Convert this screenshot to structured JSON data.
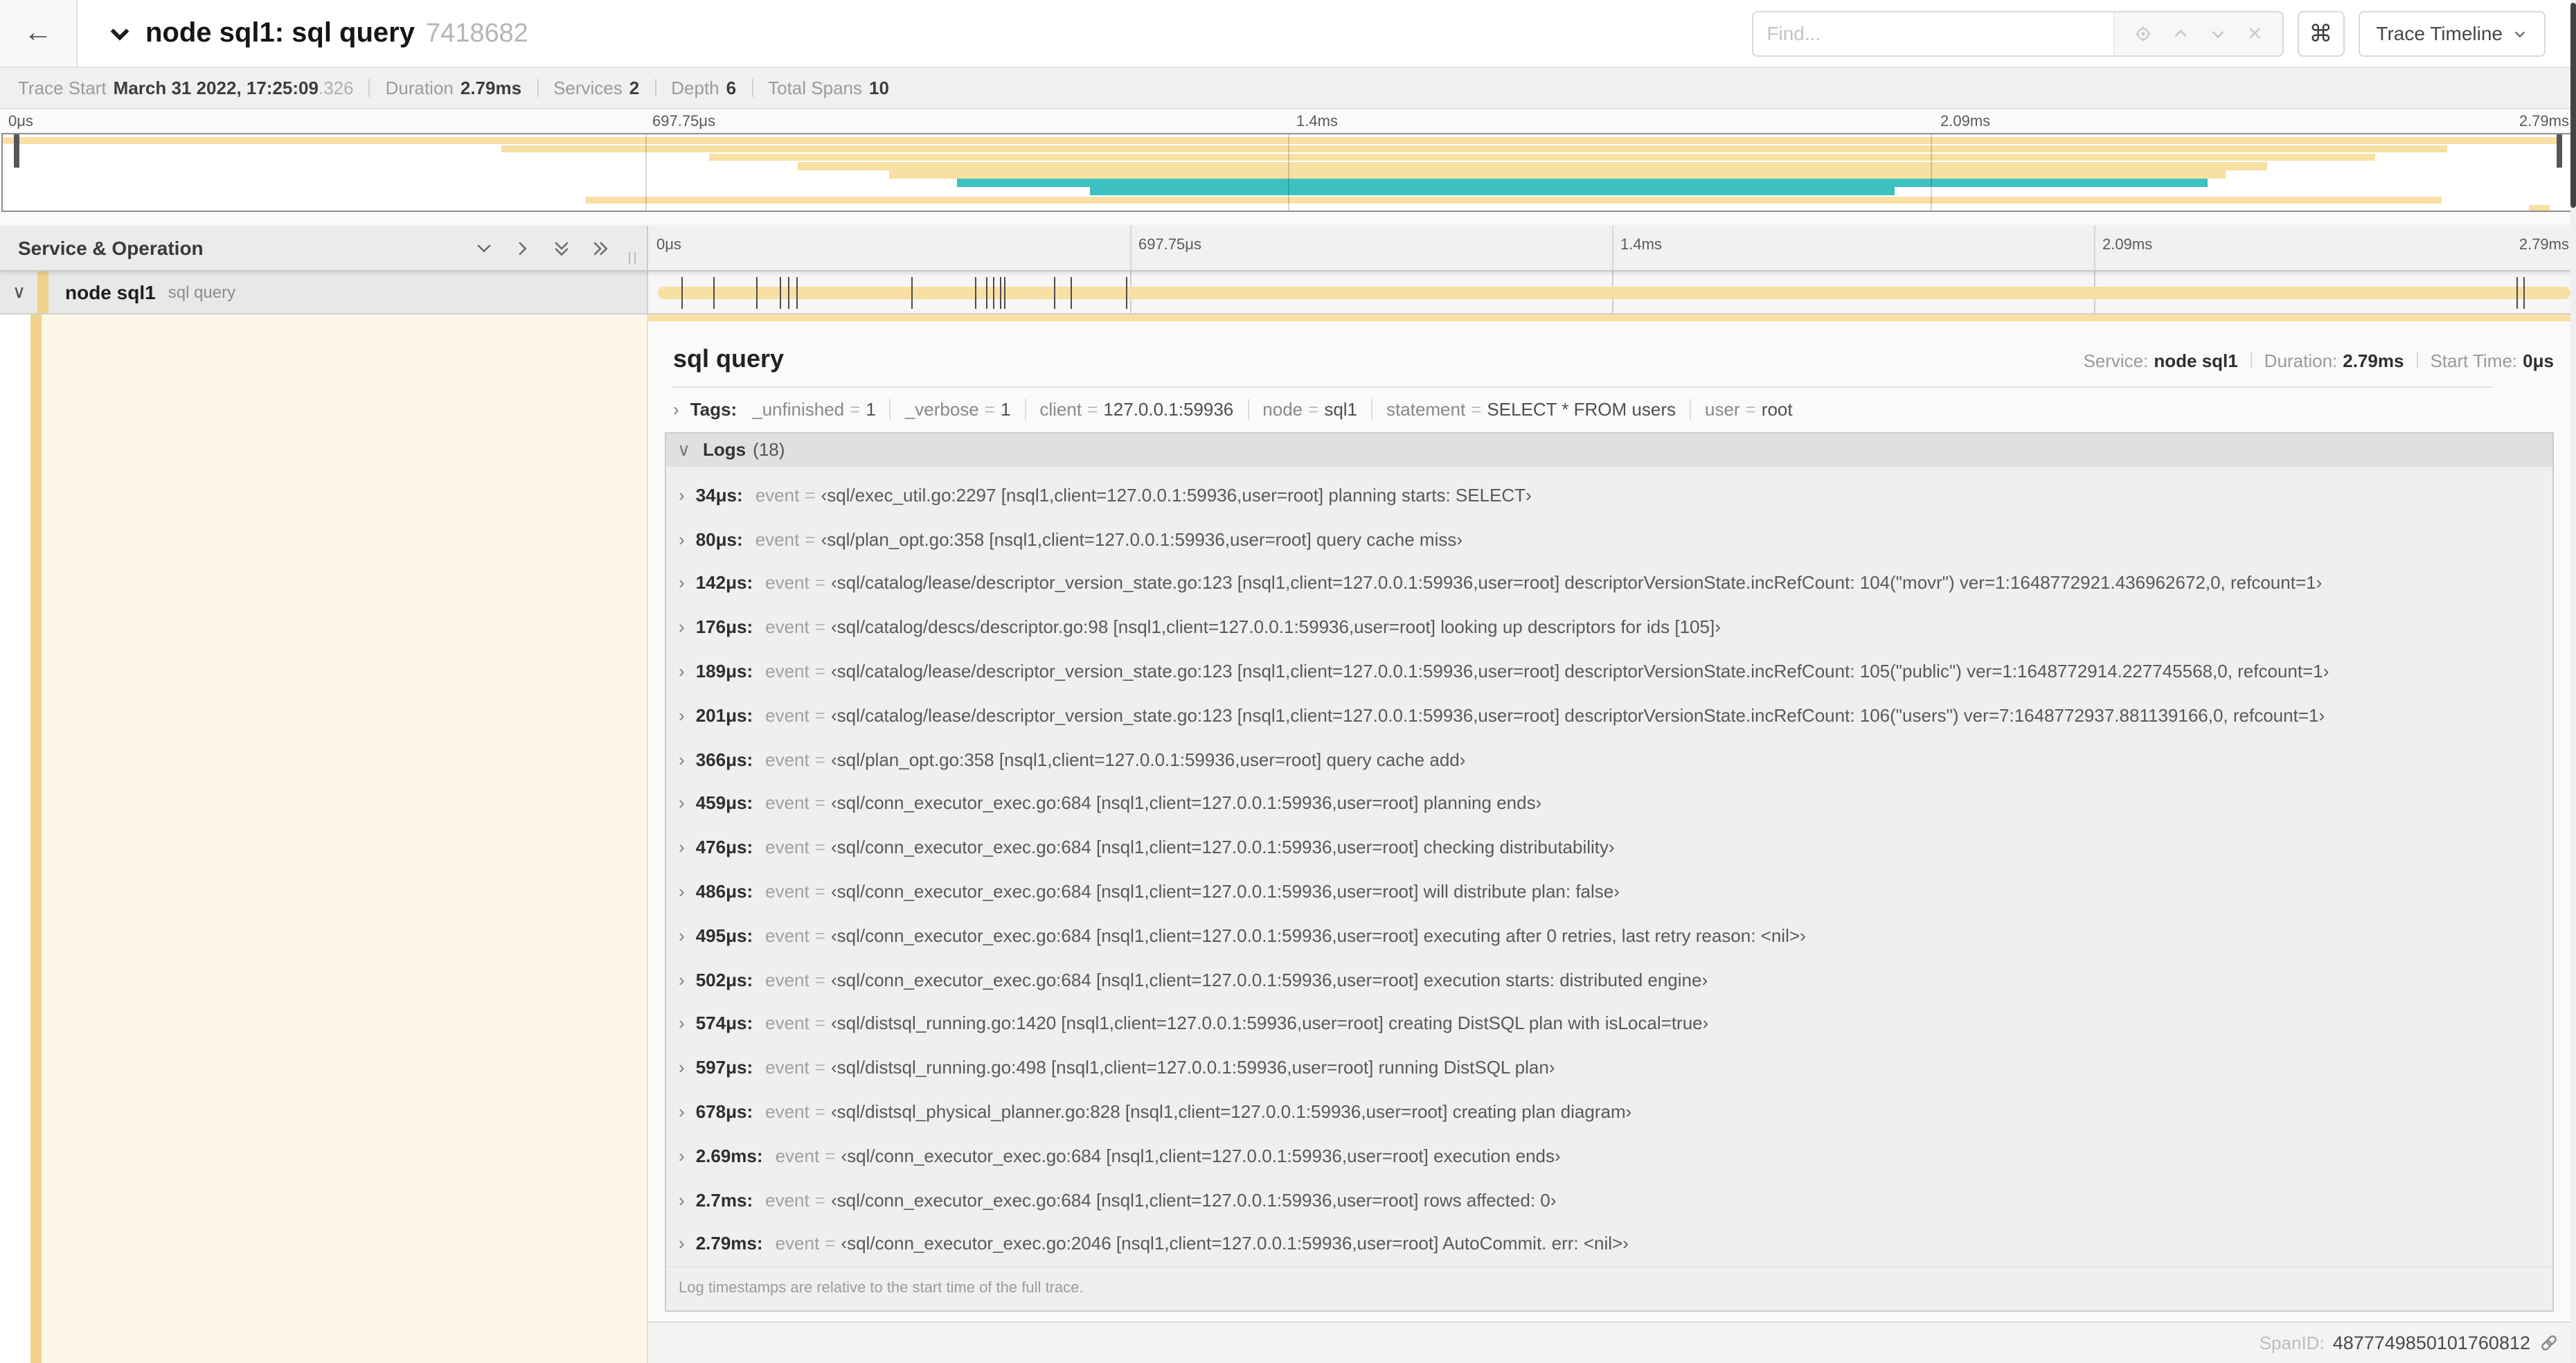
{
  "topbar": {
    "back_icon": "←",
    "title": "node sql1: sql query",
    "trace_id": "7418682",
    "find_placeholder": "Find...",
    "find_icons": [
      "locate-icon",
      "prev-result-icon",
      "next-result-icon",
      "clear-icon"
    ],
    "shortcut_icon": "⌘",
    "view_button": "Trace Timeline"
  },
  "stats": [
    {
      "name": "trace-start",
      "label": "Trace Start",
      "value": "March 31 2022, 17:25:09",
      "suffix": ".326"
    },
    {
      "name": "duration",
      "label": "Duration",
      "value": "2.79ms",
      "suffix": ""
    },
    {
      "name": "services",
      "label": "Services",
      "value": "2",
      "suffix": ""
    },
    {
      "name": "depth",
      "label": "Depth",
      "value": "6",
      "suffix": ""
    },
    {
      "name": "total-spans",
      "label": "Total Spans",
      "value": "10",
      "suffix": ""
    }
  ],
  "ruler_labels": [
    "0μs",
    "697.75μs",
    "1.4ms",
    "2.09ms",
    "2.79ms"
  ],
  "minimap": {
    "bars": [
      {
        "s": 0,
        "e": 99.4,
        "c": "tan"
      },
      {
        "s": 19.4,
        "e": 95.1,
        "c": "tan"
      },
      {
        "s": 27.5,
        "e": 92.3,
        "c": "tan"
      },
      {
        "s": 30.9,
        "e": 88.1,
        "c": "tan"
      },
      {
        "s": 34.5,
        "e": 86.5,
        "c": "tan"
      },
      {
        "s": 37.1,
        "e": 85.8,
        "c": "teal"
      },
      {
        "s": 42.3,
        "e": 73.6,
        "c": "teal"
      },
      {
        "s": 22.7,
        "e": 94.9,
        "c": "tan"
      },
      {
        "s": 98.3,
        "e": 99.1,
        "c": "tan"
      }
    ]
  },
  "timeline": {
    "header_label": "Service & Operation",
    "collapse_icons": [
      "chevron-down",
      "chevron-right",
      "double-chevron-down",
      "double-chevron-right"
    ]
  },
  "row": {
    "service": "node sql1",
    "operation": "sql query",
    "chevron": "∨"
  },
  "trace": {
    "duration_us": 2790
  },
  "detail": {
    "title": "sql query",
    "service_label": "Service:",
    "service_value": "node sql1",
    "duration_label": "Duration:",
    "duration_value": "2.79ms",
    "start_label": "Start Time:",
    "start_value": "0μs",
    "tags_label": "Tags:",
    "tags": [
      {
        "key": "_unfinished",
        "value": "1"
      },
      {
        "key": "_verbose",
        "value": "1"
      },
      {
        "key": "client",
        "value": "127.0.0.1:59936"
      },
      {
        "key": "node",
        "value": "sql1"
      },
      {
        "key": "statement",
        "value": "SELECT * FROM users"
      },
      {
        "key": "user",
        "value": "root"
      }
    ],
    "logs_label": "Logs",
    "logs_count": "(18)",
    "log_key": "event",
    "logs": [
      {
        "time": "34μs",
        "text": "sql/exec_util.go:2297 [nsql1,client=127.0.0.1:59936,user=root] planning starts: SELECT"
      },
      {
        "time": "80μs",
        "text": "sql/plan_opt.go:358 [nsql1,client=127.0.0.1:59936,user=root] query cache miss"
      },
      {
        "time": "142μs",
        "text": "sql/catalog/lease/descriptor_version_state.go:123 [nsql1,client=127.0.0.1:59936,user=root] descriptorVersionState.incRefCount: 104(\"movr\") ver=1:1648772921.436962672,0, refcount=1"
      },
      {
        "time": "176μs",
        "text": "sql/catalog/descs/descriptor.go:98 [nsql1,client=127.0.0.1:59936,user=root] looking up descriptors for ids [105]"
      },
      {
        "time": "189μs",
        "text": "sql/catalog/lease/descriptor_version_state.go:123 [nsql1,client=127.0.0.1:59936,user=root] descriptorVersionState.incRefCount: 105(\"public\") ver=1:1648772914.227745568,0, refcount=1"
      },
      {
        "time": "201μs",
        "text": "sql/catalog/lease/descriptor_version_state.go:123 [nsql1,client=127.0.0.1:59936,user=root] descriptorVersionState.incRefCount: 106(\"users\") ver=7:1648772937.881139166,0, refcount=1"
      },
      {
        "time": "366μs",
        "text": "sql/plan_opt.go:358 [nsql1,client=127.0.0.1:59936,user=root] query cache add"
      },
      {
        "time": "459μs",
        "text": "sql/conn_executor_exec.go:684 [nsql1,client=127.0.0.1:59936,user=root] planning ends"
      },
      {
        "time": "476μs",
        "text": "sql/conn_executor_exec.go:684 [nsql1,client=127.0.0.1:59936,user=root] checking distributability"
      },
      {
        "time": "486μs",
        "text": "sql/conn_executor_exec.go:684 [nsql1,client=127.0.0.1:59936,user=root] will distribute plan: false"
      },
      {
        "time": "495μs",
        "text": "sql/conn_executor_exec.go:684 [nsql1,client=127.0.0.1:59936,user=root] executing after 0 retries, last retry reason: <nil>"
      },
      {
        "time": "502μs",
        "text": "sql/conn_executor_exec.go:684 [nsql1,client=127.0.0.1:59936,user=root] execution starts: distributed engine"
      },
      {
        "time": "574μs",
        "text": "sql/distsql_running.go:1420 [nsql1,client=127.0.0.1:59936,user=root] creating DistSQL plan with isLocal=true"
      },
      {
        "time": "597μs",
        "text": "sql/distsql_running.go:498 [nsql1,client=127.0.0.1:59936,user=root] running DistSQL plan"
      },
      {
        "time": "678μs",
        "text": "sql/distsql_physical_planner.go:828 [nsql1,client=127.0.0.1:59936,user=root] creating plan diagram"
      },
      {
        "time": "2.69ms",
        "text": "sql/conn_executor_exec.go:684 [nsql1,client=127.0.0.1:59936,user=root] execution ends"
      },
      {
        "time": "2.7ms",
        "text": "sql/conn_executor_exec.go:684 [nsql1,client=127.0.0.1:59936,user=root] rows affected: 0"
      },
      {
        "time": "2.79ms",
        "text": "sql/conn_executor_exec.go:2046 [nsql1,client=127.0.0.1:59936,user=root] AutoCommit. err: <nil>"
      }
    ],
    "logs_note": "Log timestamps are relative to the start time of the full trace.",
    "span_id_label": "SpanID:",
    "span_id": "4877749850101760812",
    "link_icon": "link-icon"
  },
  "colors": {
    "accent_tan": "#f8dfa4",
    "accent_tan_strong": "#f0d28c",
    "teal": "#3dc0c0",
    "detail_bg": "#fbf6e6"
  }
}
